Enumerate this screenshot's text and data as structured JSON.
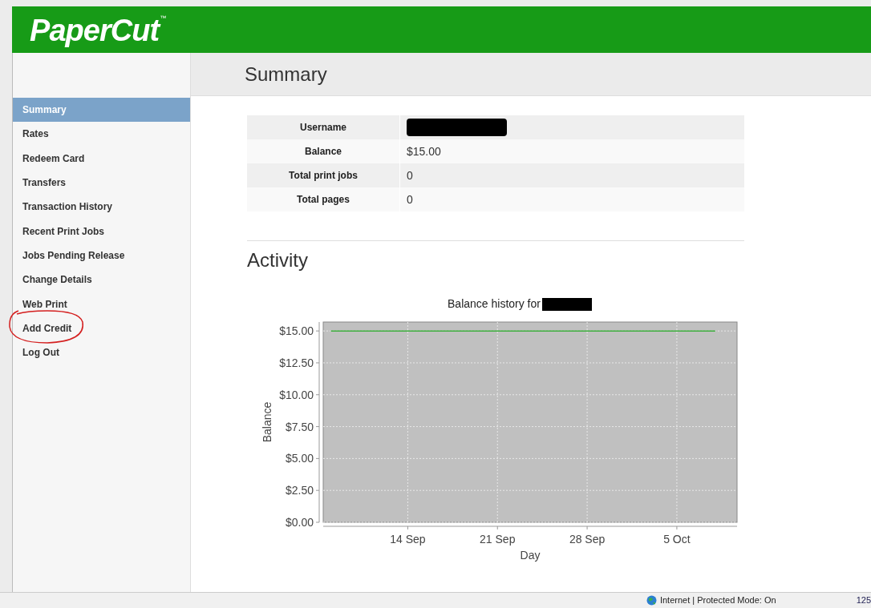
{
  "header": {
    "logo": "PaperCut",
    "trademark": "™"
  },
  "sidebar": {
    "items": [
      {
        "label": "Summary",
        "selected": true
      },
      {
        "label": "Rates",
        "selected": false
      },
      {
        "label": "Redeem Card",
        "selected": false
      },
      {
        "label": "Transfers",
        "selected": false
      },
      {
        "label": "Transaction History",
        "selected": false
      },
      {
        "label": "Recent Print Jobs",
        "selected": false
      },
      {
        "label": "Jobs Pending Release",
        "selected": false
      },
      {
        "label": "Change Details",
        "selected": false
      },
      {
        "label": "Web Print",
        "selected": false
      },
      {
        "label": "Add Credit",
        "selected": false,
        "circled": true
      },
      {
        "label": "Log Out",
        "selected": false
      }
    ]
  },
  "page_title": "Summary",
  "summary": {
    "rows": [
      {
        "label": "Username",
        "value": "",
        "redacted": true
      },
      {
        "label": "Balance",
        "value": "$15.00"
      },
      {
        "label": "Total print jobs",
        "value": "0"
      },
      {
        "label": "Total pages",
        "value": "0"
      }
    ]
  },
  "activity": {
    "title": "Activity",
    "chart_title": "Balance history for",
    "chart_title_redacted": true,
    "chart_data": {
      "type": "line",
      "xlabel": "Day",
      "ylabel": "Balance",
      "categories": [
        null,
        null,
        null,
        null,
        null,
        null,
        "14 Sep",
        null,
        null,
        null,
        null,
        null,
        null,
        "21 Sep",
        null,
        null,
        null,
        null,
        null,
        null,
        "28 Sep",
        null,
        null,
        null,
        null,
        null,
        null,
        "5 Oct",
        null,
        null,
        null
      ],
      "series": [
        {
          "color": "#3cae3c",
          "values": [
            15,
            15,
            15,
            15,
            15,
            15,
            15,
            15,
            15,
            15,
            15,
            15,
            15,
            15,
            15,
            15,
            15,
            15,
            15,
            15,
            15,
            15,
            15,
            15,
            15,
            15,
            15,
            15,
            15,
            15,
            15
          ]
        }
      ],
      "ylim": [
        0,
        15.7
      ],
      "grid": true,
      "yticks": [
        {
          "value": 0,
          "label": "$0.00"
        },
        {
          "value": 2.5,
          "label": "$2.50"
        },
        {
          "value": 5,
          "label": "$5.00"
        },
        {
          "value": 7.5,
          "label": "$7.50"
        },
        {
          "value": 10,
          "label": "$10.00"
        },
        {
          "value": 12.5,
          "label": "$12.50"
        },
        {
          "value": 15,
          "label": "$15.00"
        }
      ]
    }
  },
  "status_bar": {
    "zone": "Internet | Protected Mode: On",
    "zoom": "125"
  }
}
